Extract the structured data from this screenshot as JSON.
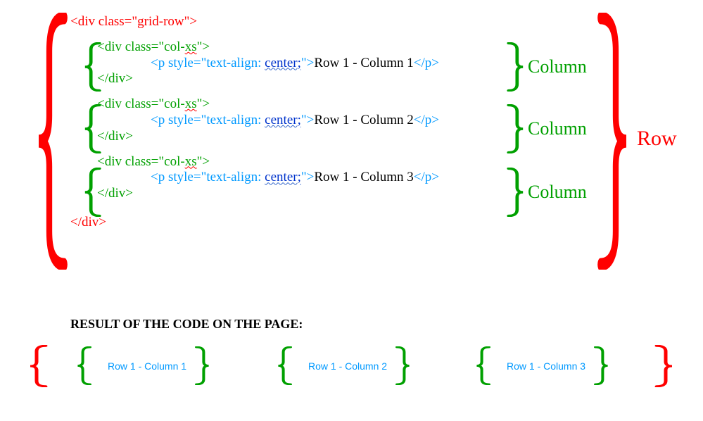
{
  "code": {
    "row_open": "<div class=\"grid-row\">",
    "row_close": "</div>",
    "col_open_prefix": "<div class=\"col-",
    "col_open_xs": "xs",
    "col_open_suffix": "\">",
    "col_close": "</div>",
    "p_open_prefix": "<p style=\"text-align: ",
    "p_center": "center;",
    "p_open_suffix": "\">",
    "p_close": "</p>",
    "col1_text": "Row 1 - Column 1",
    "col2_text": "Row 1 - Column 2",
    "col3_text": "Row 1 - Column 3"
  },
  "labels": {
    "column": "Column",
    "row": "Row"
  },
  "result": {
    "heading": "RESULT OF THE CODE ON THE PAGE:",
    "cells": [
      "Row 1 - Column 1",
      "Row 1 - Column 2",
      "Row 1 - Column 3"
    ]
  }
}
